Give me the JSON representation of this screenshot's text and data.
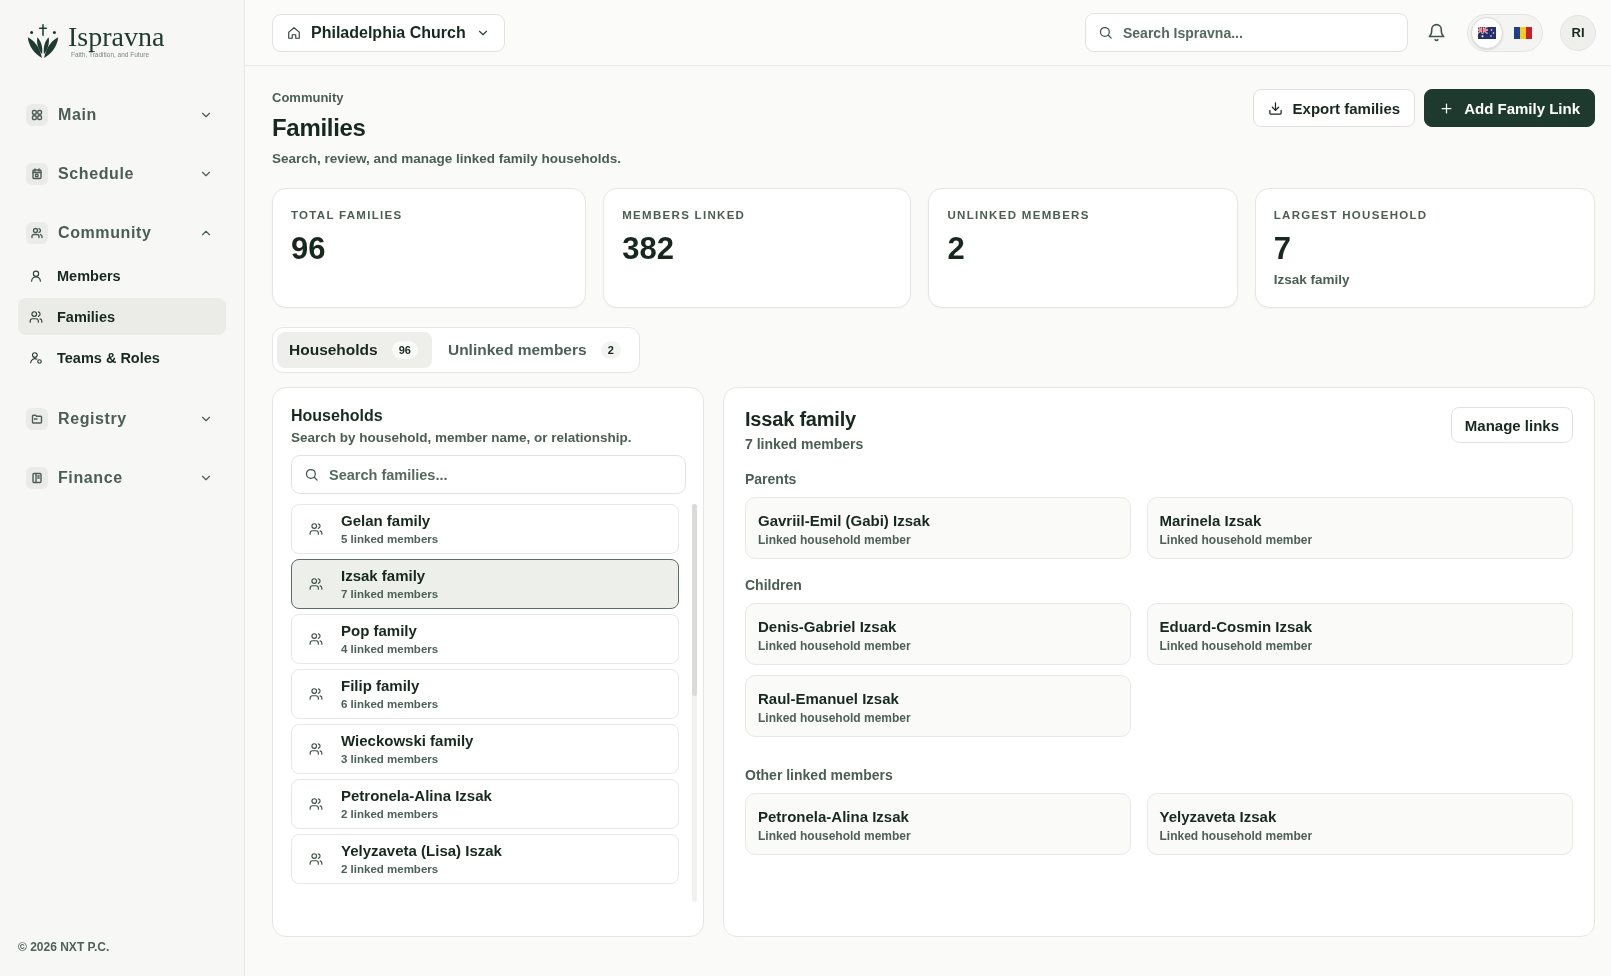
{
  "sidebar": {
    "logo": {
      "name": "Ispravna",
      "tagline": "Faith, Tradition, and Future"
    },
    "groups": [
      {
        "label": "Main",
        "expanded": false
      },
      {
        "label": "Schedule",
        "expanded": false
      },
      {
        "label": "Community",
        "expanded": true,
        "children": [
          {
            "label": "Members",
            "selected": false
          },
          {
            "label": "Families",
            "selected": true
          },
          {
            "label": "Teams & Roles",
            "selected": false
          }
        ]
      },
      {
        "label": "Registry",
        "expanded": false
      },
      {
        "label": "Finance",
        "expanded": false
      }
    ],
    "footer": "© 2026 NXT P.C."
  },
  "top_bar": {
    "church": "Philadelphia Church",
    "search": {
      "placeholder": "Search Ispravna..."
    },
    "languages": [
      {
        "kind": "au",
        "selected": true
      },
      {
        "kind": "ro",
        "selected": false
      }
    ],
    "avatar": "RI"
  },
  "page_header": {
    "breadcrumb": "Community",
    "title": "Families",
    "subtitle": "Search, review, and manage linked family households.",
    "actions": [
      {
        "label": "Export families",
        "kind": "outline"
      },
      {
        "label": "Add Family Link",
        "kind": "primary"
      }
    ]
  },
  "stats": [
    {
      "label": "TOTAL FAMILIES",
      "value": "96"
    },
    {
      "label": "MEMBERS LINKED",
      "value": "382"
    },
    {
      "label": "UNLINKED MEMBERS",
      "value": "2"
    },
    {
      "label": "LARGEST HOUSEHOLD",
      "value": "7",
      "note": "Izsak family"
    }
  ],
  "tabs": [
    {
      "label": "Households",
      "count": "96",
      "selected": true
    },
    {
      "label": "Unlinked members",
      "count": "2",
      "selected": false
    }
  ],
  "households_panel": {
    "title": "Households",
    "subtitle": "Search by household, member name, or relationship.",
    "search": {
      "placeholder": "Search families..."
    },
    "items": [
      {
        "name": "Gelan family",
        "count": "5 linked members",
        "selected": false
      },
      {
        "name": "Izsak family",
        "count": "7 linked members",
        "selected": true
      },
      {
        "name": "Pop family",
        "count": "4 linked members",
        "selected": false
      },
      {
        "name": "Filip family",
        "count": "6 linked members",
        "selected": false
      },
      {
        "name": "Wieckowski family",
        "count": "3 linked members",
        "selected": false
      },
      {
        "name": "Petronela-Alina Izsak",
        "count": "2 linked members",
        "selected": false
      },
      {
        "name": "Yelyzaveta (Lisa) Iszak",
        "count": "2 linked members",
        "selected": false
      }
    ]
  },
  "family_detail": {
    "title": "Issak family",
    "subtitle": "7 linked members",
    "button": "Manage links",
    "sections": [
      {
        "title": "Parents",
        "members": [
          {
            "name": "Gavriil-Emil (Gabi) Izsak",
            "role": "Linked household member"
          },
          {
            "name": "Marinela Izsak",
            "role": "Linked household member"
          }
        ]
      },
      {
        "title": "Children",
        "members": [
          {
            "name": "Denis-Gabriel Izsak",
            "role": "Linked household member"
          },
          {
            "name": "Eduard-Cosmin Izsak",
            "role": "Linked household member"
          },
          {
            "name": "Raul-Emanuel Izsak",
            "role": "Linked household member"
          }
        ]
      },
      {
        "title": "Other linked members",
        "members": [
          {
            "name": "Petronela-Alina Izsak",
            "role": "Linked household member"
          },
          {
            "name": "Yelyzaveta Izsak",
            "role": "Linked household member"
          }
        ]
      }
    ]
  }
}
